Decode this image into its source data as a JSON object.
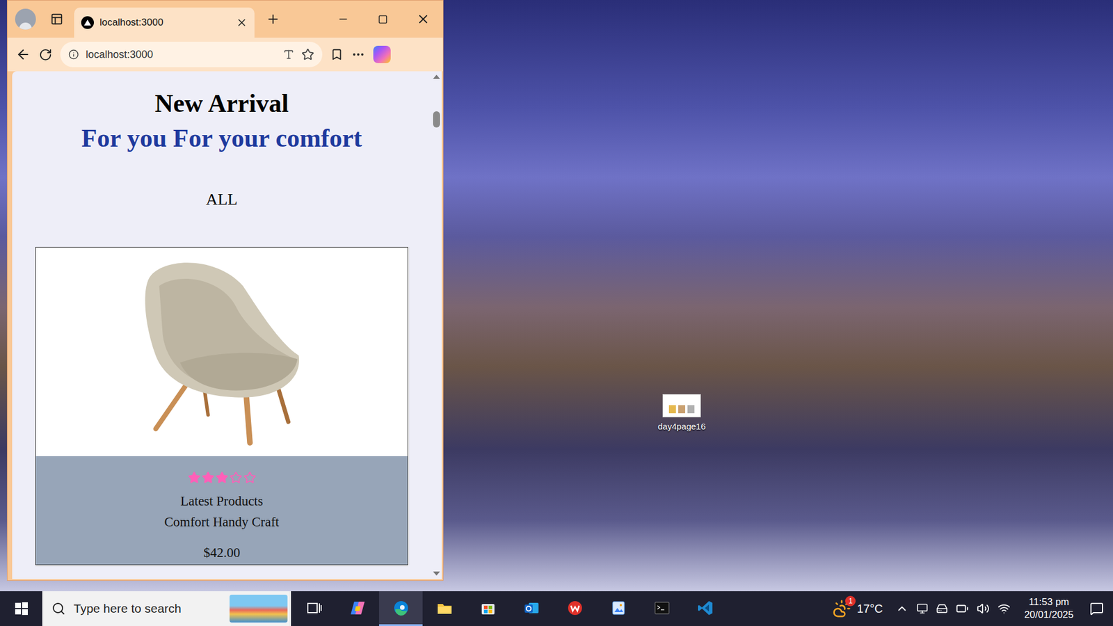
{
  "browser": {
    "tab": {
      "title": "localhost:3000",
      "selected": true
    },
    "address": "localhost:3000"
  },
  "page": {
    "heading": "New Arrival",
    "subheading": "For you For your comfort",
    "filter": "ALL",
    "products": [
      {
        "stars": 3,
        "category": "Latest Products",
        "name": "Comfort Handy Craft",
        "price": "$42.00"
      }
    ]
  },
  "desktop": {
    "icons": [
      {
        "label": "day4page16"
      }
    ]
  },
  "taskbar": {
    "search_placeholder": "Type here to search",
    "apps": [
      {
        "kind": "taskview",
        "active": false
      },
      {
        "kind": "copilot",
        "active": false
      },
      {
        "kind": "edge",
        "active": true
      },
      {
        "kind": "explorer",
        "active": false
      },
      {
        "kind": "store",
        "active": false
      },
      {
        "kind": "outlook",
        "active": false
      },
      {
        "kind": "wps",
        "active": false
      },
      {
        "kind": "paint",
        "active": false
      },
      {
        "kind": "terminal",
        "active": false
      },
      {
        "kind": "vscode",
        "active": false
      }
    ],
    "weather": {
      "temperature": "17°C",
      "badge": "1"
    },
    "clock": {
      "time": "11:53 pm",
      "date": "20/01/2025"
    }
  }
}
